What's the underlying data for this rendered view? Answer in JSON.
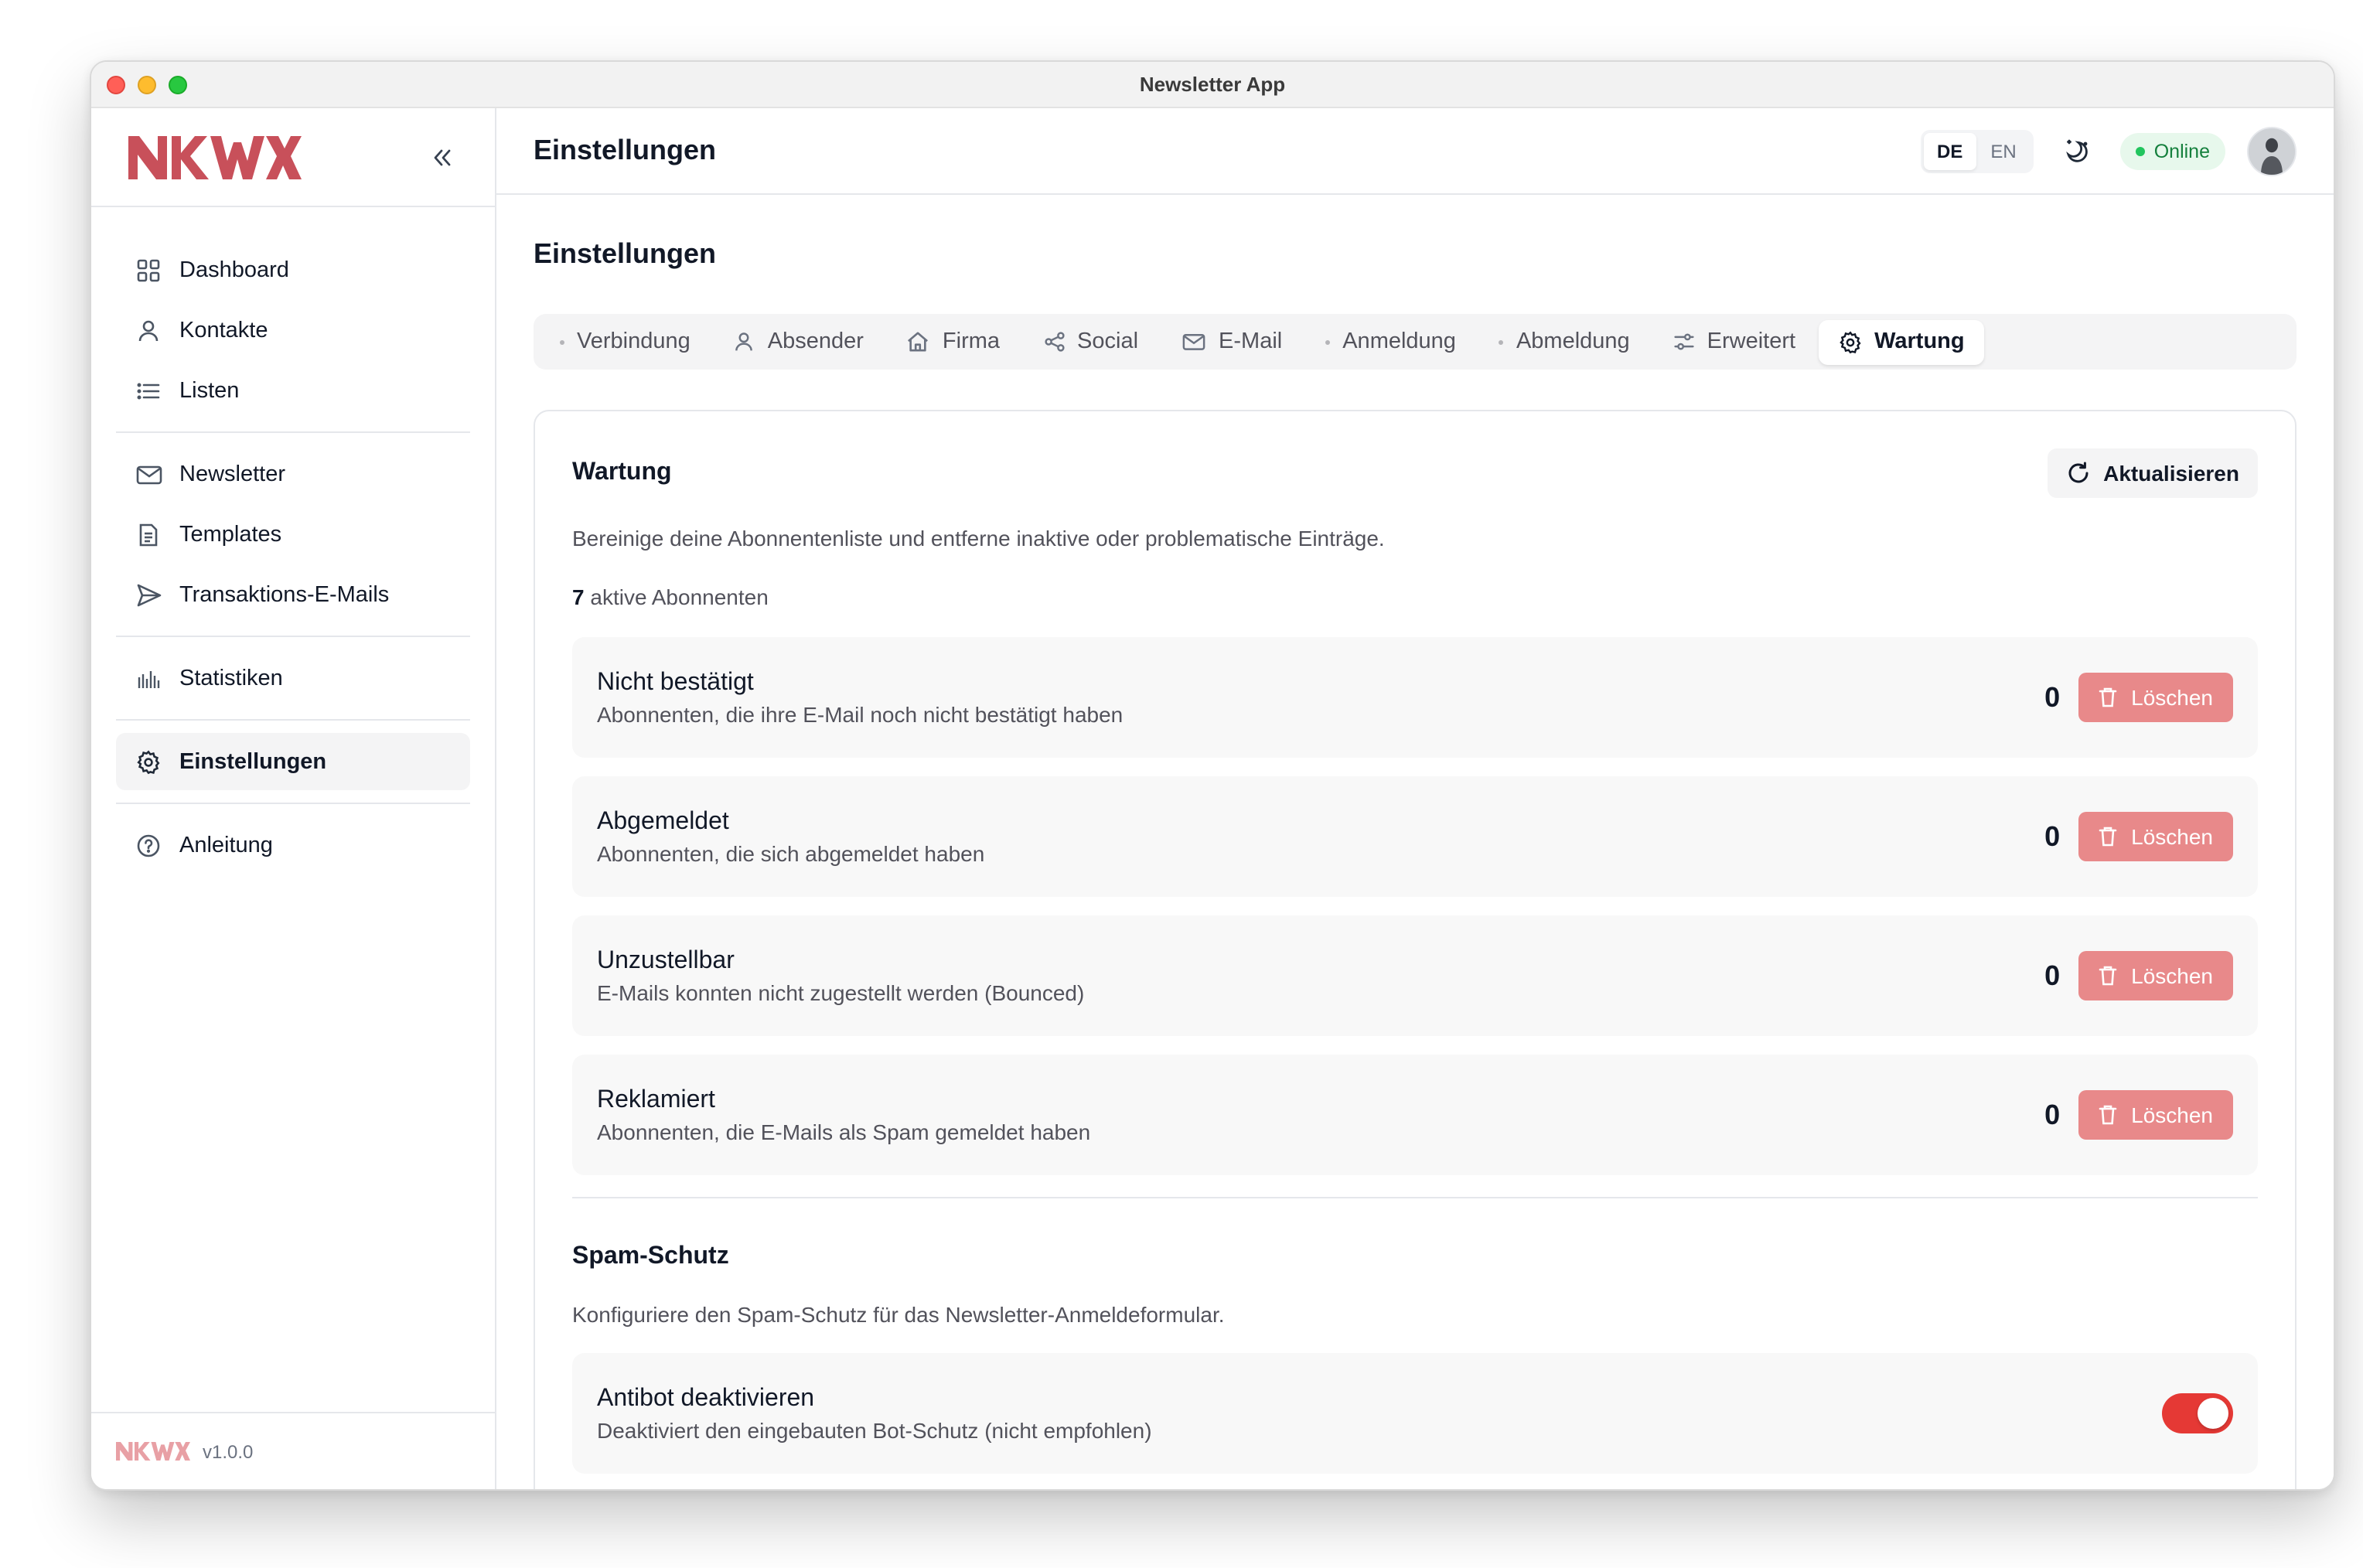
{
  "window": {
    "title": "Newsletter App"
  },
  "brand": {
    "logo_text": "NKWX",
    "logo_color": "#c8505a",
    "version": "v1.0.0"
  },
  "sidebar": {
    "groups": [
      [
        {
          "label": "Dashboard",
          "icon": "grid-icon"
        },
        {
          "label": "Kontakte",
          "icon": "user-icon"
        },
        {
          "label": "Listen",
          "icon": "list-icon"
        }
      ],
      [
        {
          "label": "Newsletter",
          "icon": "mail-icon"
        },
        {
          "label": "Templates",
          "icon": "document-icon"
        },
        {
          "label": "Transaktions-E-Mails",
          "icon": "send-icon"
        }
      ],
      [
        {
          "label": "Statistiken",
          "icon": "bar-chart-icon"
        }
      ],
      [
        {
          "label": "Einstellungen",
          "icon": "gear-icon",
          "active": true
        }
      ],
      [
        {
          "label": "Anleitung",
          "icon": "help-circle-icon"
        }
      ]
    ]
  },
  "header": {
    "title": "Einstellungen",
    "languages": [
      "DE",
      "EN"
    ],
    "selected_language": "DE",
    "status": "Online",
    "status_color": "#22c55e"
  },
  "page": {
    "title": "Einstellungen",
    "tabs": [
      {
        "label": "Verbindung",
        "icon": "dot"
      },
      {
        "label": "Absender",
        "icon": "user-icon"
      },
      {
        "label": "Firma",
        "icon": "home-icon"
      },
      {
        "label": "Social",
        "icon": "share-icon"
      },
      {
        "label": "E-Mail",
        "icon": "mail-icon"
      },
      {
        "label": "Anmeldung",
        "icon": "dot"
      },
      {
        "label": "Abmeldung",
        "icon": "dot"
      },
      {
        "label": "Erweitert",
        "icon": "sliders-icon"
      },
      {
        "label": "Wartung",
        "icon": "gear-icon",
        "active": true
      }
    ]
  },
  "maintenance": {
    "title": "Wartung",
    "refresh_label": "Aktualisieren",
    "description": "Bereinige deine Abonnentenliste und entferne inaktive oder problematische Einträge.",
    "active_count": "7",
    "active_label": "aktive Abonnenten",
    "delete_label": "Löschen",
    "delete_color": "#e8898a",
    "rows": [
      {
        "title": "Nicht bestätigt",
        "subtitle": "Abonnenten, die ihre E-Mail noch nicht bestätigt haben",
        "count": "0"
      },
      {
        "title": "Abgemeldet",
        "subtitle": "Abonnenten, die sich abgemeldet haben",
        "count": "0"
      },
      {
        "title": "Unzustellbar",
        "subtitle": "E-Mails konnten nicht zugestellt werden (Bounced)",
        "count": "0"
      },
      {
        "title": "Reklamiert",
        "subtitle": "Abonnenten, die E-Mails als Spam gemeldet haben",
        "count": "0"
      }
    ]
  },
  "spam": {
    "title": "Spam-Schutz",
    "description": "Konfiguriere den Spam-Schutz für das Newsletter-Anmeldeformular.",
    "toggle": {
      "title": "Antibot deaktivieren",
      "subtitle": "Deaktiviert den eingebauten Bot-Schutz (nicht empfohlen)",
      "on": true,
      "color": "#e53935"
    }
  }
}
